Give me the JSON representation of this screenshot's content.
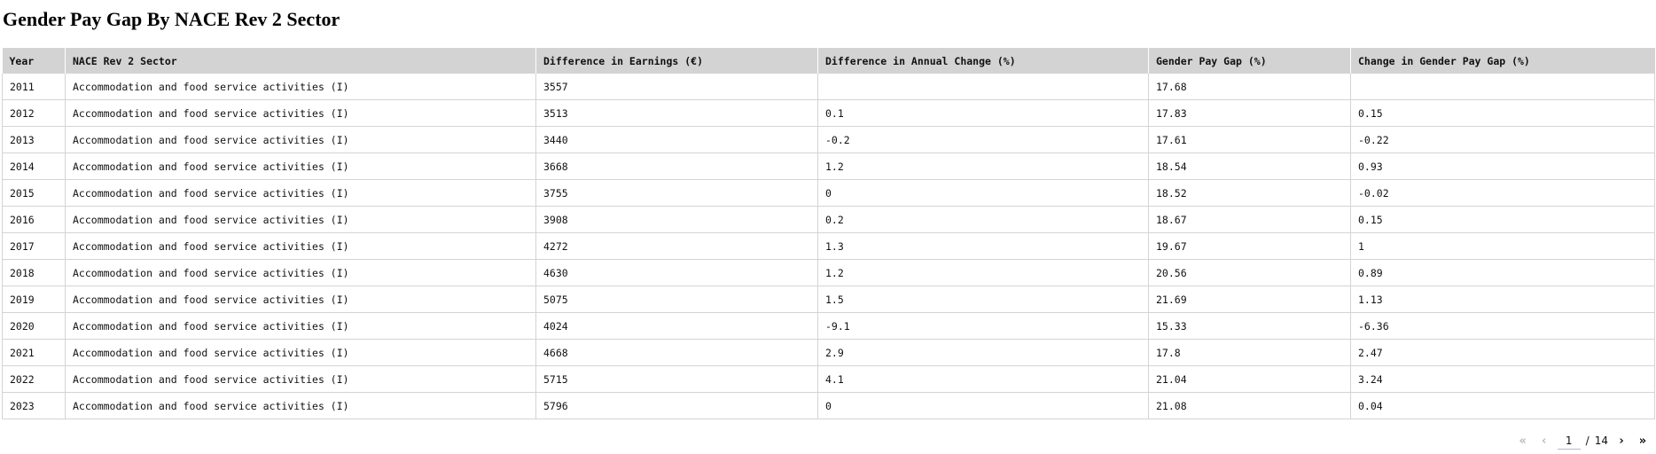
{
  "page": {
    "title": "Gender Pay Gap By NACE Rev 2 Sector"
  },
  "table": {
    "columns": [
      "Year",
      "NACE Rev 2 Sector",
      "Difference in Earnings (€)",
      "Difference in Annual Change (%)",
      "Gender Pay Gap (%)",
      "Change in Gender Pay Gap (%)"
    ],
    "rows": [
      [
        "2011",
        "Accommodation and food service activities (I)",
        "3557",
        "",
        "17.68",
        ""
      ],
      [
        "2012",
        "Accommodation and food service activities (I)",
        "3513",
        "0.1",
        "17.83",
        "0.15"
      ],
      [
        "2013",
        "Accommodation and food service activities (I)",
        "3440",
        "-0.2",
        "17.61",
        "-0.22"
      ],
      [
        "2014",
        "Accommodation and food service activities (I)",
        "3668",
        "1.2",
        "18.54",
        "0.93"
      ],
      [
        "2015",
        "Accommodation and food service activities (I)",
        "3755",
        "0",
        "18.52",
        "-0.02"
      ],
      [
        "2016",
        "Accommodation and food service activities (I)",
        "3908",
        "0.2",
        "18.67",
        "0.15"
      ],
      [
        "2017",
        "Accommodation and food service activities (I)",
        "4272",
        "1.3",
        "19.67",
        "1"
      ],
      [
        "2018",
        "Accommodation and food service activities (I)",
        "4630",
        "1.2",
        "20.56",
        "0.89"
      ],
      [
        "2019",
        "Accommodation and food service activities (I)",
        "5075",
        "1.5",
        "21.69",
        "1.13"
      ],
      [
        "2020",
        "Accommodation and food service activities (I)",
        "4024",
        "-9.1",
        "15.33",
        "-6.36"
      ],
      [
        "2021",
        "Accommodation and food service activities (I)",
        "4668",
        "2.9",
        "17.8",
        "2.47"
      ],
      [
        "2022",
        "Accommodation and food service activities (I)",
        "5715",
        "4.1",
        "21.04",
        "3.24"
      ],
      [
        "2023",
        "Accommodation and food service activities (I)",
        "5796",
        "0",
        "21.08",
        "0.04"
      ]
    ]
  },
  "pagination": {
    "current_page": "1",
    "separator": "/",
    "total_pages": "14",
    "first_icon": "double-chevron-left-icon",
    "prev_icon": "chevron-left-icon",
    "next_icon": "chevron-right-icon",
    "last_icon": "double-chevron-right-icon"
  }
}
